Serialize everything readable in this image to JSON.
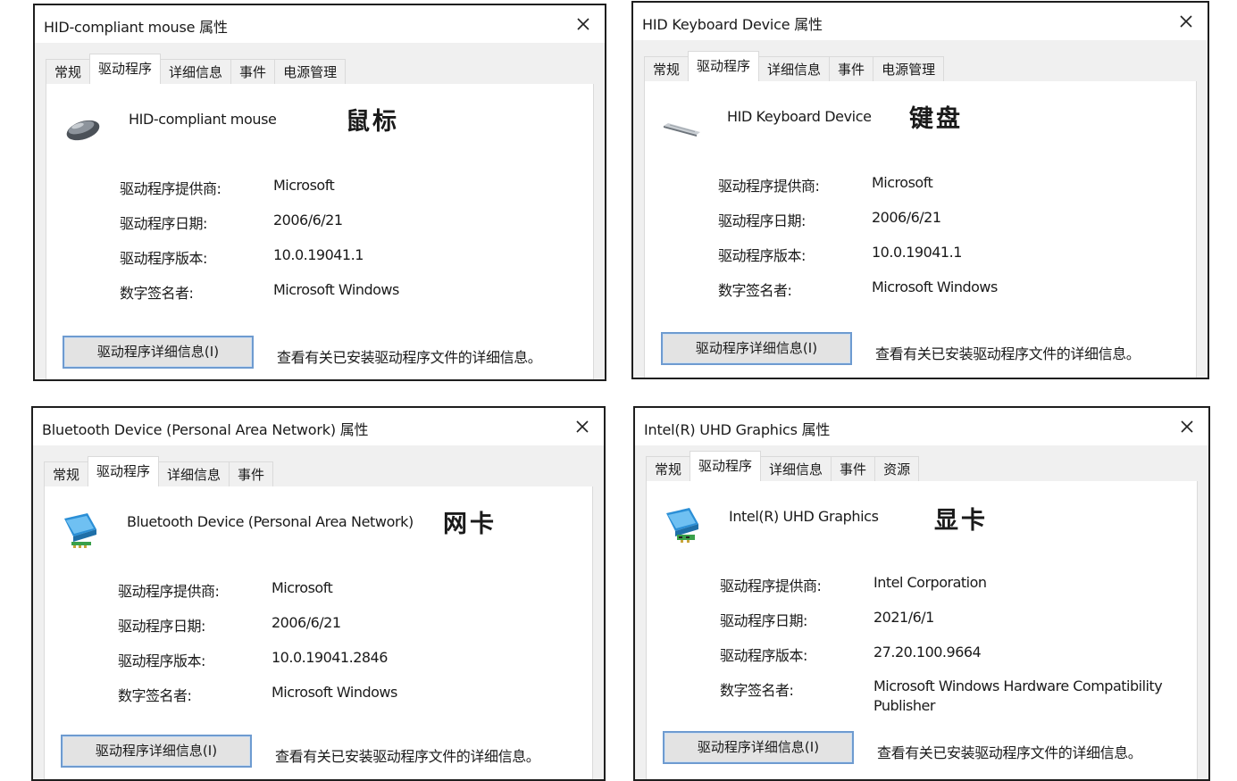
{
  "labels": {
    "provider": "驱动程序提供商:",
    "date": "驱动程序日期:",
    "version": "驱动程序版本:",
    "signer": "数字签名者:",
    "details_button": "驱动程序详细信息(I)",
    "details_desc": "查看有关已安装驱动程序文件的详细信息。"
  },
  "dialogs": [
    {
      "title": "HID-compliant mouse 属性",
      "tabs": [
        "常规",
        "驱动程序",
        "详细信息",
        "事件",
        "电源管理"
      ],
      "active_tab": "驱动程序",
      "device_icon": "mouse-icon",
      "device_name": "HID-compliant mouse",
      "annotation": "鼠标",
      "provider": "Microsoft",
      "date": "2006/6/21",
      "version": "10.0.19041.1",
      "signer": "Microsoft Windows"
    },
    {
      "title": "HID Keyboard Device 属性",
      "tabs": [
        "常规",
        "驱动程序",
        "详细信息",
        "事件",
        "电源管理"
      ],
      "active_tab": "驱动程序",
      "device_icon": "keyboard-icon",
      "device_name": "HID Keyboard Device",
      "annotation": "键盘",
      "provider": "Microsoft",
      "date": "2006/6/21",
      "version": "10.0.19041.1",
      "signer": "Microsoft Windows"
    },
    {
      "title": "Bluetooth Device (Personal Area Network) 属性",
      "tabs": [
        "常规",
        "驱动程序",
        "详细信息",
        "事件"
      ],
      "active_tab": "驱动程序",
      "device_icon": "network-adapter-icon",
      "device_name": "Bluetooth Device (Personal Area Network)",
      "annotation": "网卡",
      "provider": "Microsoft",
      "date": "2006/6/21",
      "version": "10.0.19041.2846",
      "signer": "Microsoft Windows"
    },
    {
      "title": "Intel(R) UHD Graphics 属性",
      "tabs": [
        "常规",
        "驱动程序",
        "详细信息",
        "事件",
        "资源"
      ],
      "active_tab": "驱动程序",
      "device_icon": "display-adapter-icon",
      "device_name": "Intel(R) UHD Graphics",
      "annotation": "显卡",
      "provider": "Intel Corporation",
      "date": "2021/6/1",
      "version": "27.20.100.9664",
      "signer": "Microsoft Windows Hardware Compatibility Publisher"
    }
  ]
}
